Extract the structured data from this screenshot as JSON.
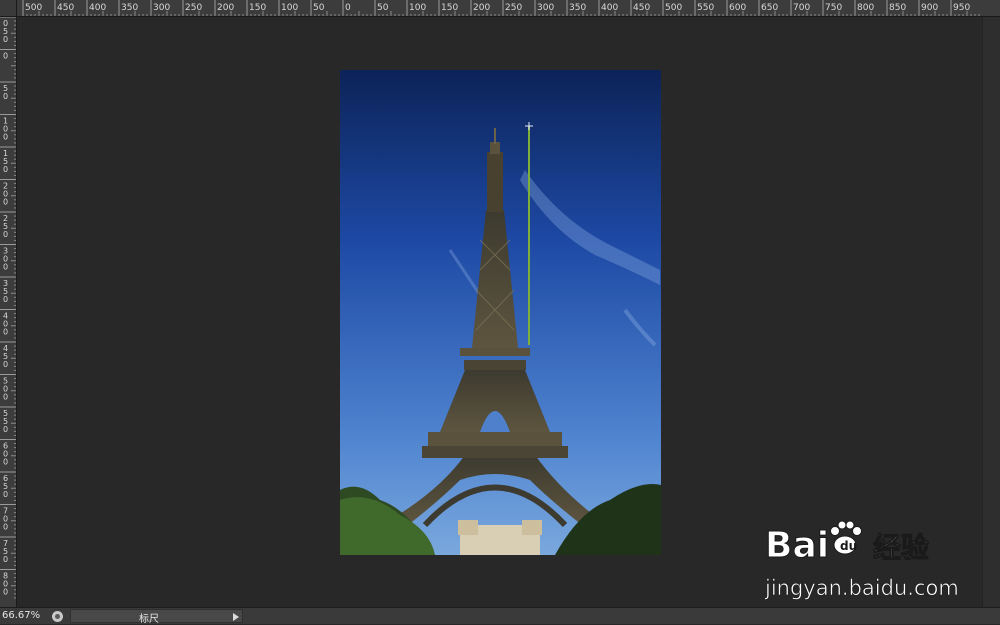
{
  "rulers": {
    "horizontal_labels": [
      "500",
      "450",
      "400",
      "350",
      "300",
      "250",
      "200",
      "150",
      "100",
      "50",
      "0",
      "50",
      "100",
      "150",
      "200",
      "250",
      "300",
      "350",
      "400",
      "450",
      "500",
      "550",
      "600",
      "650",
      "700",
      "750",
      "800",
      "850",
      "900",
      "950"
    ],
    "vertical_labels": [
      "050",
      "0",
      "50",
      "100",
      "150",
      "200",
      "250",
      "300",
      "350",
      "400",
      "450",
      "500",
      "550",
      "600",
      "650",
      "700",
      "750",
      "800"
    ]
  },
  "status_bar": {
    "zoom": "66.67%",
    "info_label": "标尺"
  },
  "watermark": {
    "brand": "Bai",
    "brand_suffix": "经验",
    "url": "jingyan.baidu.com"
  },
  "colors": {
    "workspace": "#282828",
    "ruler": "#3c3c3c",
    "sky_top": "#0c2358",
    "sky_bottom": "#5f92d6",
    "measure_line": "#7fae3a"
  }
}
